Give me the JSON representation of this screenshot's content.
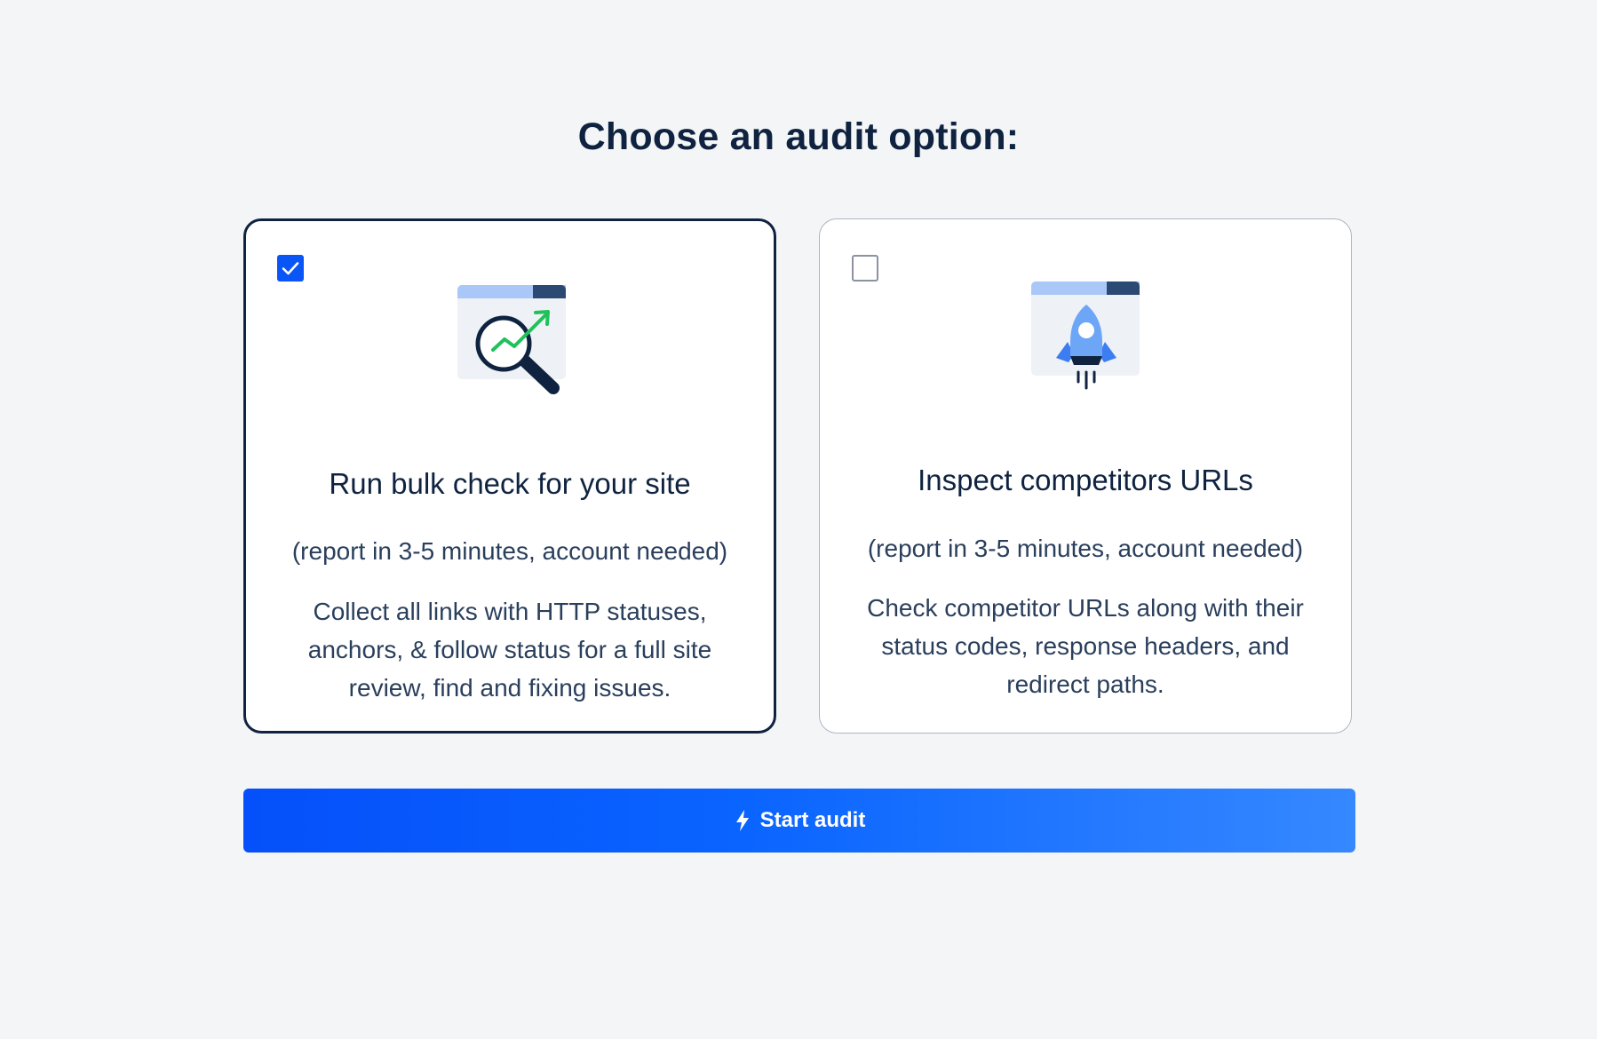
{
  "heading": "Choose an audit option:",
  "options": [
    {
      "title": "Run bulk check for your site",
      "meta": "(report in 3-5 minutes, account needed)",
      "description": "Collect all links with HTTP statuses, anchors, & follow status for a full site review, find and fixing issues.",
      "selected": true,
      "icon": "magnifier-growth-icon"
    },
    {
      "title": "Inspect competitors URLs",
      "meta": "(report in 3-5 minutes, account needed)",
      "description": "Check competitor URLs along with their status codes, response headers, and redirect paths.",
      "selected": false,
      "icon": "rocket-icon"
    }
  ],
  "start_button": {
    "label": "Start audit",
    "icon": "lightning-icon"
  },
  "colors": {
    "background": "#f3f5f7",
    "accent": "#0a55f5",
    "text_dark": "#0f2340",
    "text_body": "#2a3f5c",
    "growth_green": "#1fc25a"
  }
}
